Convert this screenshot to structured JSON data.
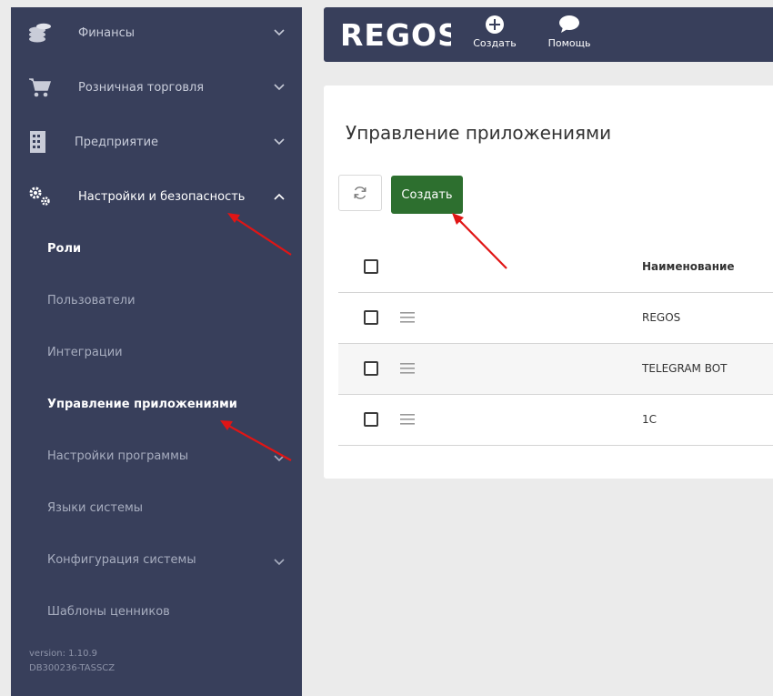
{
  "sidebar": {
    "items": [
      {
        "label": "Финансы",
        "icon": "coins-icon"
      },
      {
        "label": "Розничная торговля",
        "icon": "cart-icon"
      },
      {
        "label": "Предприятие",
        "icon": "building-icon"
      },
      {
        "label": "Настройки и безопасность",
        "icon": "gears-icon"
      }
    ],
    "subitems": [
      {
        "label": "Роли"
      },
      {
        "label": "Пользователи"
      },
      {
        "label": "Интеграции"
      },
      {
        "label": "Управление приложениями"
      },
      {
        "label": "Настройки программы"
      },
      {
        "label": "Языки системы"
      },
      {
        "label": "Конфигурация системы"
      },
      {
        "label": "Шаблоны ценников"
      }
    ],
    "version": "version: 1.10.9",
    "db": "DB300236-TASSCZ"
  },
  "header": {
    "logo": "REGOS",
    "create_label": "Создать",
    "help_label": "Помощь"
  },
  "main": {
    "title": "Управление приложениями",
    "create_button": "Создать",
    "table": {
      "column_name": "Наименование",
      "rows": [
        {
          "name": "REGOS"
        },
        {
          "name": "TELEGRAM BOT"
        },
        {
          "name": "1C"
        }
      ]
    }
  },
  "colors": {
    "sidebar_bg": "#383f5b",
    "create_green": "#2d6f2f",
    "annotation_arrow": "#e01515"
  }
}
